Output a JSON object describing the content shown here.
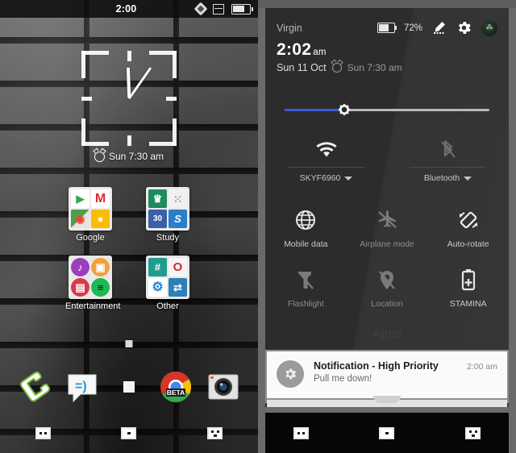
{
  "home": {
    "statusbar": {
      "time": "2:00",
      "icons": [
        "diamond-icon",
        "tofu-placeholder-icon",
        "battery-icon"
      ]
    },
    "clock_widget": {
      "alarm_text": "Sun 7:30 am",
      "alarm_icon": "alarm-clock-icon",
      "hour_hand_angle": -92,
      "minute_hand_angle": -55
    },
    "folders": [
      {
        "label": "Google",
        "apps": [
          {
            "name": "Play Store",
            "glyph": "▶",
            "bg": "#ffffff",
            "fg": "#34a853"
          },
          {
            "name": "Gmail",
            "glyph": "M",
            "bg": "#ffffff",
            "fg": "#d93025"
          },
          {
            "name": "Maps",
            "glyph": "◉",
            "bg": "#5b9a4e",
            "fg": "#ea4335"
          },
          {
            "name": "Keep",
            "glyph": "●",
            "bg": "#fbbc04",
            "fg": "#ffffff"
          }
        ]
      },
      {
        "label": "Study",
        "apps": [
          {
            "name": "Dictionary",
            "glyph": "♛",
            "bg": "#1e8a5f",
            "fg": "#ffffff"
          },
          {
            "name": "Circles App",
            "glyph": "⁙",
            "bg": "#f0f0f0",
            "fg": "#9a9a9a"
          },
          {
            "name": "Calendar",
            "glyph": "30",
            "bg": "#3b5fa8",
            "fg": "#ffffff"
          },
          {
            "name": "Scanner",
            "glyph": "S",
            "bg": "#2a7fc9",
            "fg": "#ffffff"
          }
        ]
      }
    ],
    "folders_row2": [
      {
        "label": "Entertainment",
        "apps": [
          {
            "name": "Music",
            "glyph": "♪",
            "bg": "#9b3fbf",
            "fg": "#ffffff"
          },
          {
            "name": "Gallery",
            "glyph": "▣",
            "bg": "#f2a03c",
            "fg": "#ffffff"
          },
          {
            "name": "Video",
            "glyph": "▤",
            "bg": "#d83a48",
            "fg": "#ffffff"
          },
          {
            "name": "Spotify",
            "glyph": "≡",
            "bg": "#1db954",
            "fg": "#0a0a0a"
          }
        ]
      },
      {
        "label": "Other",
        "apps": [
          {
            "name": "Hash App",
            "glyph": "#",
            "bg": "#1f9c8f",
            "fg": "#ffffff"
          },
          {
            "name": "Opera",
            "glyph": "O",
            "bg": "#f5f5f5",
            "fg": "#d2262e"
          },
          {
            "name": "Settings",
            "glyph": "⚙",
            "bg": "#1f87d6",
            "fg": "#ffffff"
          },
          {
            "name": "File Transfer",
            "glyph": "⇄",
            "bg": "#2f7fb8",
            "fg": "#ffffff"
          }
        ]
      }
    ],
    "dock": [
      {
        "name": "Phone",
        "label": "Phone"
      },
      {
        "name": "Messaging",
        "label": "Messaging"
      },
      {
        "name": "Apps Drawer",
        "label": "Apps"
      },
      {
        "name": "Chrome Beta",
        "label": "BETA"
      },
      {
        "name": "Camera",
        "label": "Camera"
      }
    ],
    "navbar": [
      "back-button",
      "home-button",
      "recents-button"
    ]
  },
  "quicksettings": {
    "carrier": "Virgin",
    "battery_percent": "72%",
    "status_icons": [
      "battery-icon",
      "edit-icon",
      "settings-gear-icon",
      "user-avatar-icon"
    ],
    "clock": {
      "time": "2:02",
      "meridiem": "am",
      "date": "Sun 11 Oct",
      "alarm": "Sun 7:30 am"
    },
    "brightness": {
      "label": "Brightness",
      "value_percent": 29,
      "fill_color": "#3b5bd2",
      "track_color": "#b9b9b9",
      "thumb_icon": "brightness-sun-icon"
    },
    "connections": [
      {
        "name": "wifi",
        "icon": "wifi-icon",
        "label": "SKYF6960",
        "state": "on"
      },
      {
        "name": "bluetooth",
        "icon": "bluetooth-off-icon",
        "label": "Bluetooth",
        "state": "off"
      }
    ],
    "tiles": [
      [
        {
          "name": "mobile-data",
          "icon": "globe-icon",
          "label": "Mobile data",
          "state": "on"
        },
        {
          "name": "airplane-mode",
          "icon": "airplane-off-icon",
          "label": "Airplane mode",
          "state": "off"
        },
        {
          "name": "auto-rotate",
          "icon": "auto-rotate-icon",
          "label": "Auto-rotate",
          "state": "on"
        }
      ],
      [
        {
          "name": "flashlight",
          "icon": "flashlight-off-icon",
          "label": "Flashlight",
          "state": "off"
        },
        {
          "name": "location",
          "icon": "location-off-icon",
          "label": "Location",
          "state": "off"
        },
        {
          "name": "stamina",
          "icon": "battery-plus-icon",
          "label": "STAMINA",
          "state": "on"
        }
      ]
    ],
    "background_label": "Apps",
    "notification": {
      "icon": "gear-icon",
      "title": "Notification - High Priority",
      "body": "Pull me down!",
      "time": "2:00 am"
    },
    "navbar": [
      "back-button",
      "home-button",
      "recents-button"
    ]
  }
}
